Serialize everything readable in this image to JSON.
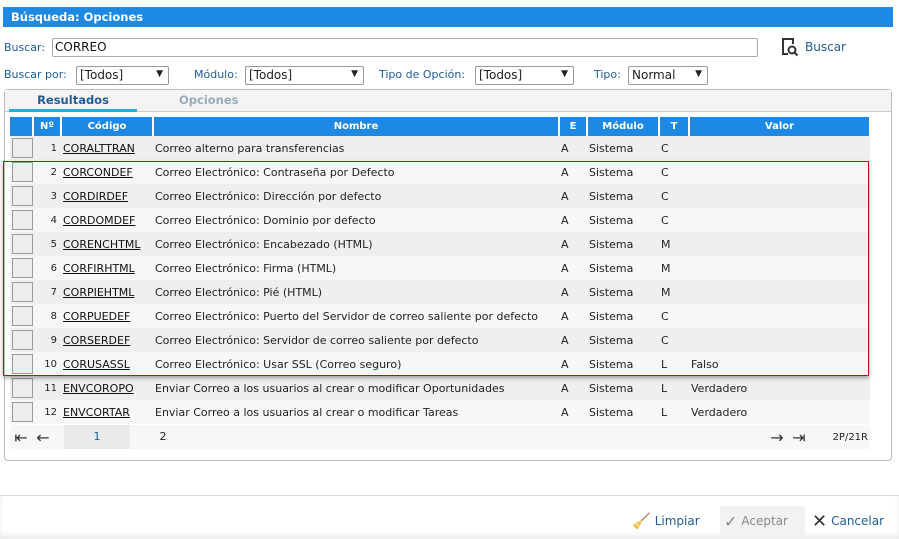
{
  "title": "Búsqueda: Opciones",
  "search": {
    "label": "Buscar:",
    "value": "CORREO",
    "button": "Buscar"
  },
  "filters": {
    "buscar_por_label": "Buscar por:",
    "buscar_por": "[Todos]",
    "modulo_label": "Módulo:",
    "modulo": "[Todos]",
    "tipo_opcion_label": "Tipo de Opción:",
    "tipo_opcion": "[Todos]",
    "tipo_label": "Tipo:",
    "tipo": "Normal"
  },
  "tabs": [
    "Resultados",
    "Opciones"
  ],
  "columns": [
    "",
    "Nº",
    "Código",
    "Nombre",
    "E",
    "Módulo",
    "T",
    "Valor"
  ],
  "rows": [
    {
      "n": "1",
      "codigo": "CORALTTRAN",
      "nombre": "Correo alterno para transferencias",
      "e": "A",
      "modulo": "Sistema",
      "t": "C",
      "valor": ""
    },
    {
      "n": "2",
      "codigo": "CORCONDEF",
      "nombre": "Correo Electrónico: Contraseña por Defecto",
      "e": "A",
      "modulo": "Sistema",
      "t": "C",
      "valor": ""
    },
    {
      "n": "3",
      "codigo": "CORDIRDEF",
      "nombre": "Correo Electrónico: Dirección por defecto",
      "e": "A",
      "modulo": "Sistema",
      "t": "C",
      "valor": ""
    },
    {
      "n": "4",
      "codigo": "CORDOMDEF",
      "nombre": "Correo Electrónico: Dominio por defecto",
      "e": "A",
      "modulo": "Sistema",
      "t": "C",
      "valor": ""
    },
    {
      "n": "5",
      "codigo": "CORENCHTML",
      "nombre": "Correo Electrónico: Encabezado (HTML)",
      "e": "A",
      "modulo": "Sistema",
      "t": "M",
      "valor": ""
    },
    {
      "n": "6",
      "codigo": "CORFIRHTML",
      "nombre": "Correo Electrónico: Firma (HTML)",
      "e": "A",
      "modulo": "Sistema",
      "t": "M",
      "valor": ""
    },
    {
      "n": "7",
      "codigo": "CORPIEHTML",
      "nombre": "Correo Electrónico: Pié (HTML)",
      "e": "A",
      "modulo": "Sistema",
      "t": "M",
      "valor": ""
    },
    {
      "n": "8",
      "codigo": "CORPUEDEF",
      "nombre": "Correo Electrónico: Puerto del Servidor de correo saliente por defecto",
      "e": "A",
      "modulo": "Sistema",
      "t": "C",
      "valor": ""
    },
    {
      "n": "9",
      "codigo": "CORSERDEF",
      "nombre": "Correo Electrónico: Servidor de correo saliente por defecto",
      "e": "A",
      "modulo": "Sistema",
      "t": "C",
      "valor": ""
    },
    {
      "n": "10",
      "codigo": "CORUSASSL",
      "nombre": "Correo Electrónico: Usar SSL (Correo seguro)",
      "e": "A",
      "modulo": "Sistema",
      "t": "L",
      "valor": "Falso"
    },
    {
      "n": "11",
      "codigo": "ENVCOROPO",
      "nombre": "Enviar Correo a los usuarios al crear o modificar Oportunidades",
      "e": "A",
      "modulo": "Sistema",
      "t": "L",
      "valor": "Verdadero"
    },
    {
      "n": "12",
      "codigo": "ENVCORTAR",
      "nombre": "Enviar Correo a los usuarios al crear o modificar Tareas",
      "e": "A",
      "modulo": "Sistema",
      "t": "L",
      "valor": "Verdadero"
    }
  ],
  "pager": {
    "pages": [
      "1",
      "2"
    ],
    "summary": "2P/21R"
  },
  "footer": {
    "limpiar": "Limpiar",
    "aceptar": "Aceptar",
    "cancelar": "Cancelar"
  }
}
